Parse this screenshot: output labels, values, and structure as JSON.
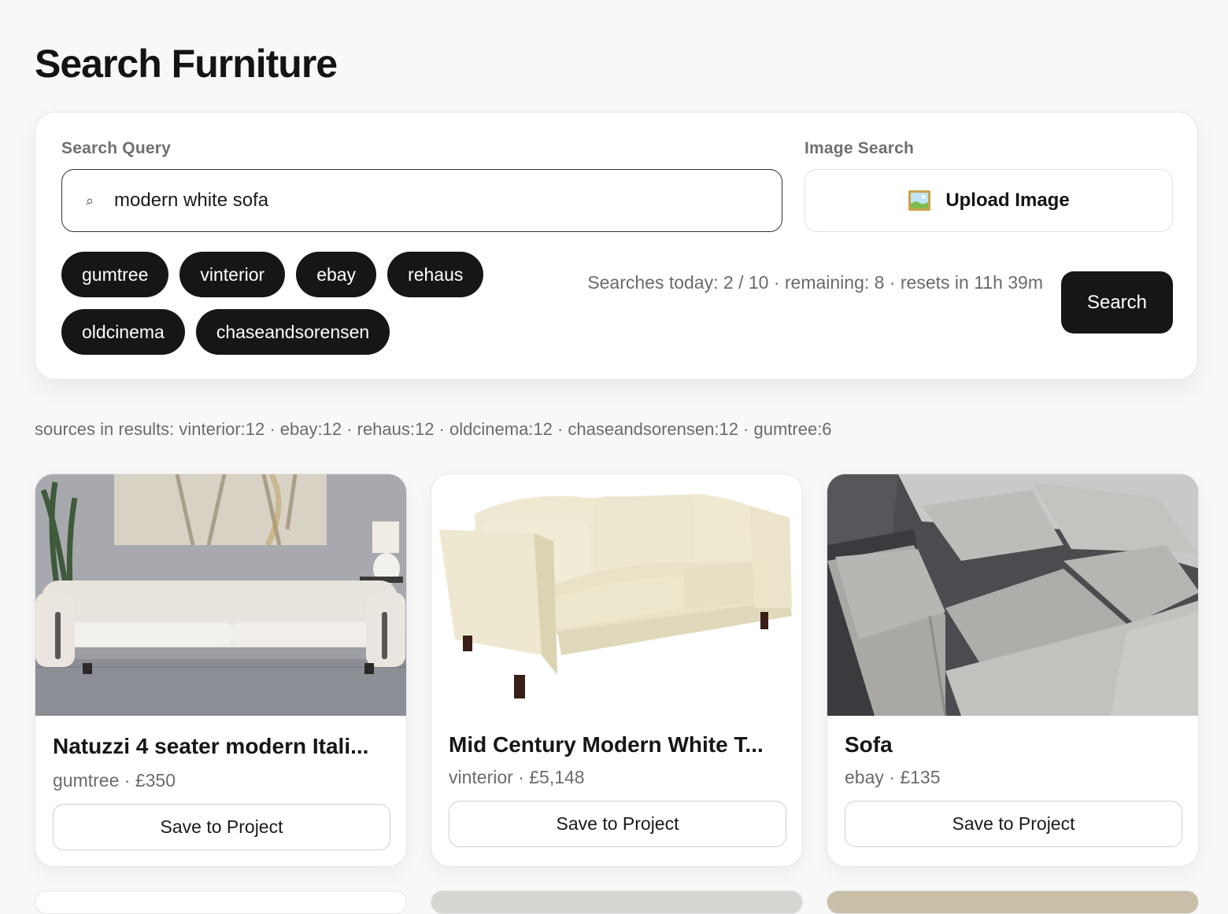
{
  "page": {
    "title": "Search Furniture"
  },
  "search": {
    "query_label": "Search Query",
    "query_value": "modern white sofa",
    "image_label": "Image Search",
    "upload_label": "Upload Image",
    "sources": [
      "gumtree",
      "vinterior",
      "ebay",
      "rehaus",
      "oldcinema",
      "chaseandsorensen"
    ],
    "quota_text": "Searches today: 2 / 10 · remaining: 8 · resets in 11h 39m",
    "search_button": "Search"
  },
  "results_summary": "sources in results: vinterior:12 · ebay:12 · rehaus:12 · oldcinema:12 · chaseandsorensen:12 · gumtree:6",
  "results": [
    {
      "title": "Natuzzi 4 seater modern Itali...",
      "meta": "gumtree · £350",
      "save_label": "Save to Project",
      "image": "white-chesterfield-sofa-photo"
    },
    {
      "title": "Mid Century Modern White T...",
      "meta": "vinterior · £5,148",
      "save_label": "Save to Project",
      "image": "cream-boucle-two-seater-photo"
    },
    {
      "title": "Sofa",
      "meta": "ebay · £135",
      "save_label": "Save to Project",
      "image": "grey-corner-sofa-photo"
    }
  ],
  "icons": {
    "search": "search-icon",
    "upload": "framed-picture-icon"
  },
  "colors": {
    "background": "#f8f8f8",
    "chip": "#161616",
    "primary_button": "#161616",
    "muted_text": "#6b6b6b"
  }
}
